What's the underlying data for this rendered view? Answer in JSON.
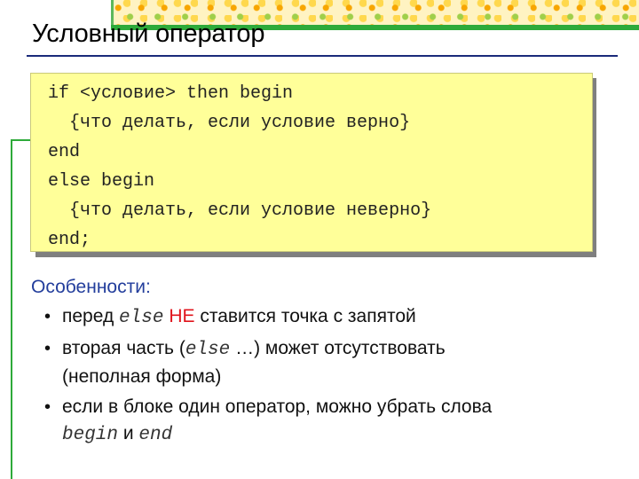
{
  "slide": {
    "title": "Условный оператор"
  },
  "code": {
    "lines": [
      "if <условие> then begin",
      "  {что делать, если условие верно}",
      "end",
      "else begin",
      "  {что делать, если условие неверно}",
      "end;"
    ]
  },
  "features": {
    "heading": "Особенности:",
    "bullet_char": "•",
    "items": [
      {
        "parts": [
          "перед ",
          "else",
          " ",
          "НЕ",
          " ставится точка с запятой"
        ]
      },
      {
        "parts": [
          "вторая часть (",
          "else",
          " …) может отсутствовать",
          "(неполная форма)"
        ]
      },
      {
        "parts": [
          "если в блоке один оператор, можно убрать слова",
          "begin",
          " и ",
          "end"
        ]
      }
    ]
  },
  "colors": {
    "accent_blue": "#233e9c",
    "highlight_red": "#e0141c",
    "code_background": "#ffff99",
    "decor_green": "#2eaa3a"
  }
}
